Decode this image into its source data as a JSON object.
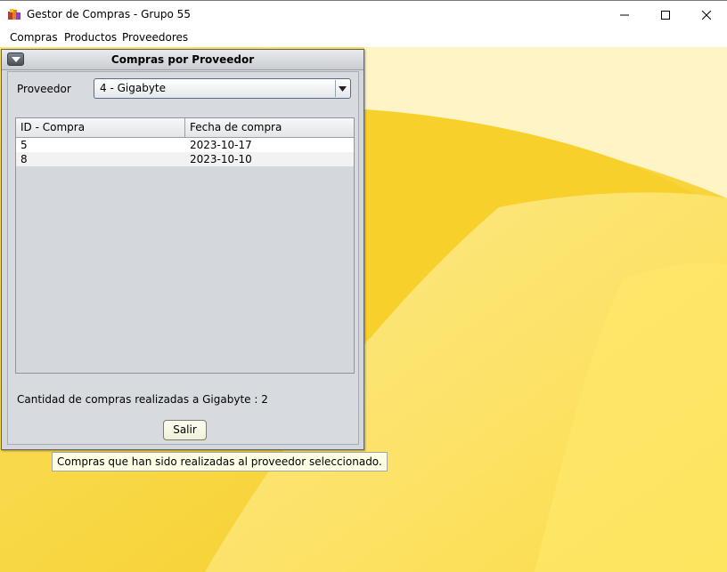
{
  "window": {
    "title": "Gestor de Compras - Grupo 55",
    "icon": "app-icon"
  },
  "menu": {
    "items": [
      "Compras",
      "Productos",
      "Proveedores"
    ]
  },
  "dialog": {
    "title": "Compras por Proveedor",
    "proveedor_label": "Proveedor",
    "proveedor_selected": "4 - Gigabyte",
    "table": {
      "columns": [
        "ID - Compra",
        "Fecha de compra"
      ],
      "rows": [
        [
          "5",
          "2023-10-17"
        ],
        [
          "8",
          "2023-10-10"
        ]
      ]
    },
    "summary": "Cantidad de compras realizadas a Gigabyte : 2",
    "exit_button": "Salir"
  },
  "tooltip": {
    "text": "Compras que han sido realizadas al proveedor seleccionado."
  },
  "colors": {
    "desktop_yellow": "#fbd933",
    "frame_bg": "#d4d7dc",
    "tooltip_bg": "#ffffe6"
  }
}
